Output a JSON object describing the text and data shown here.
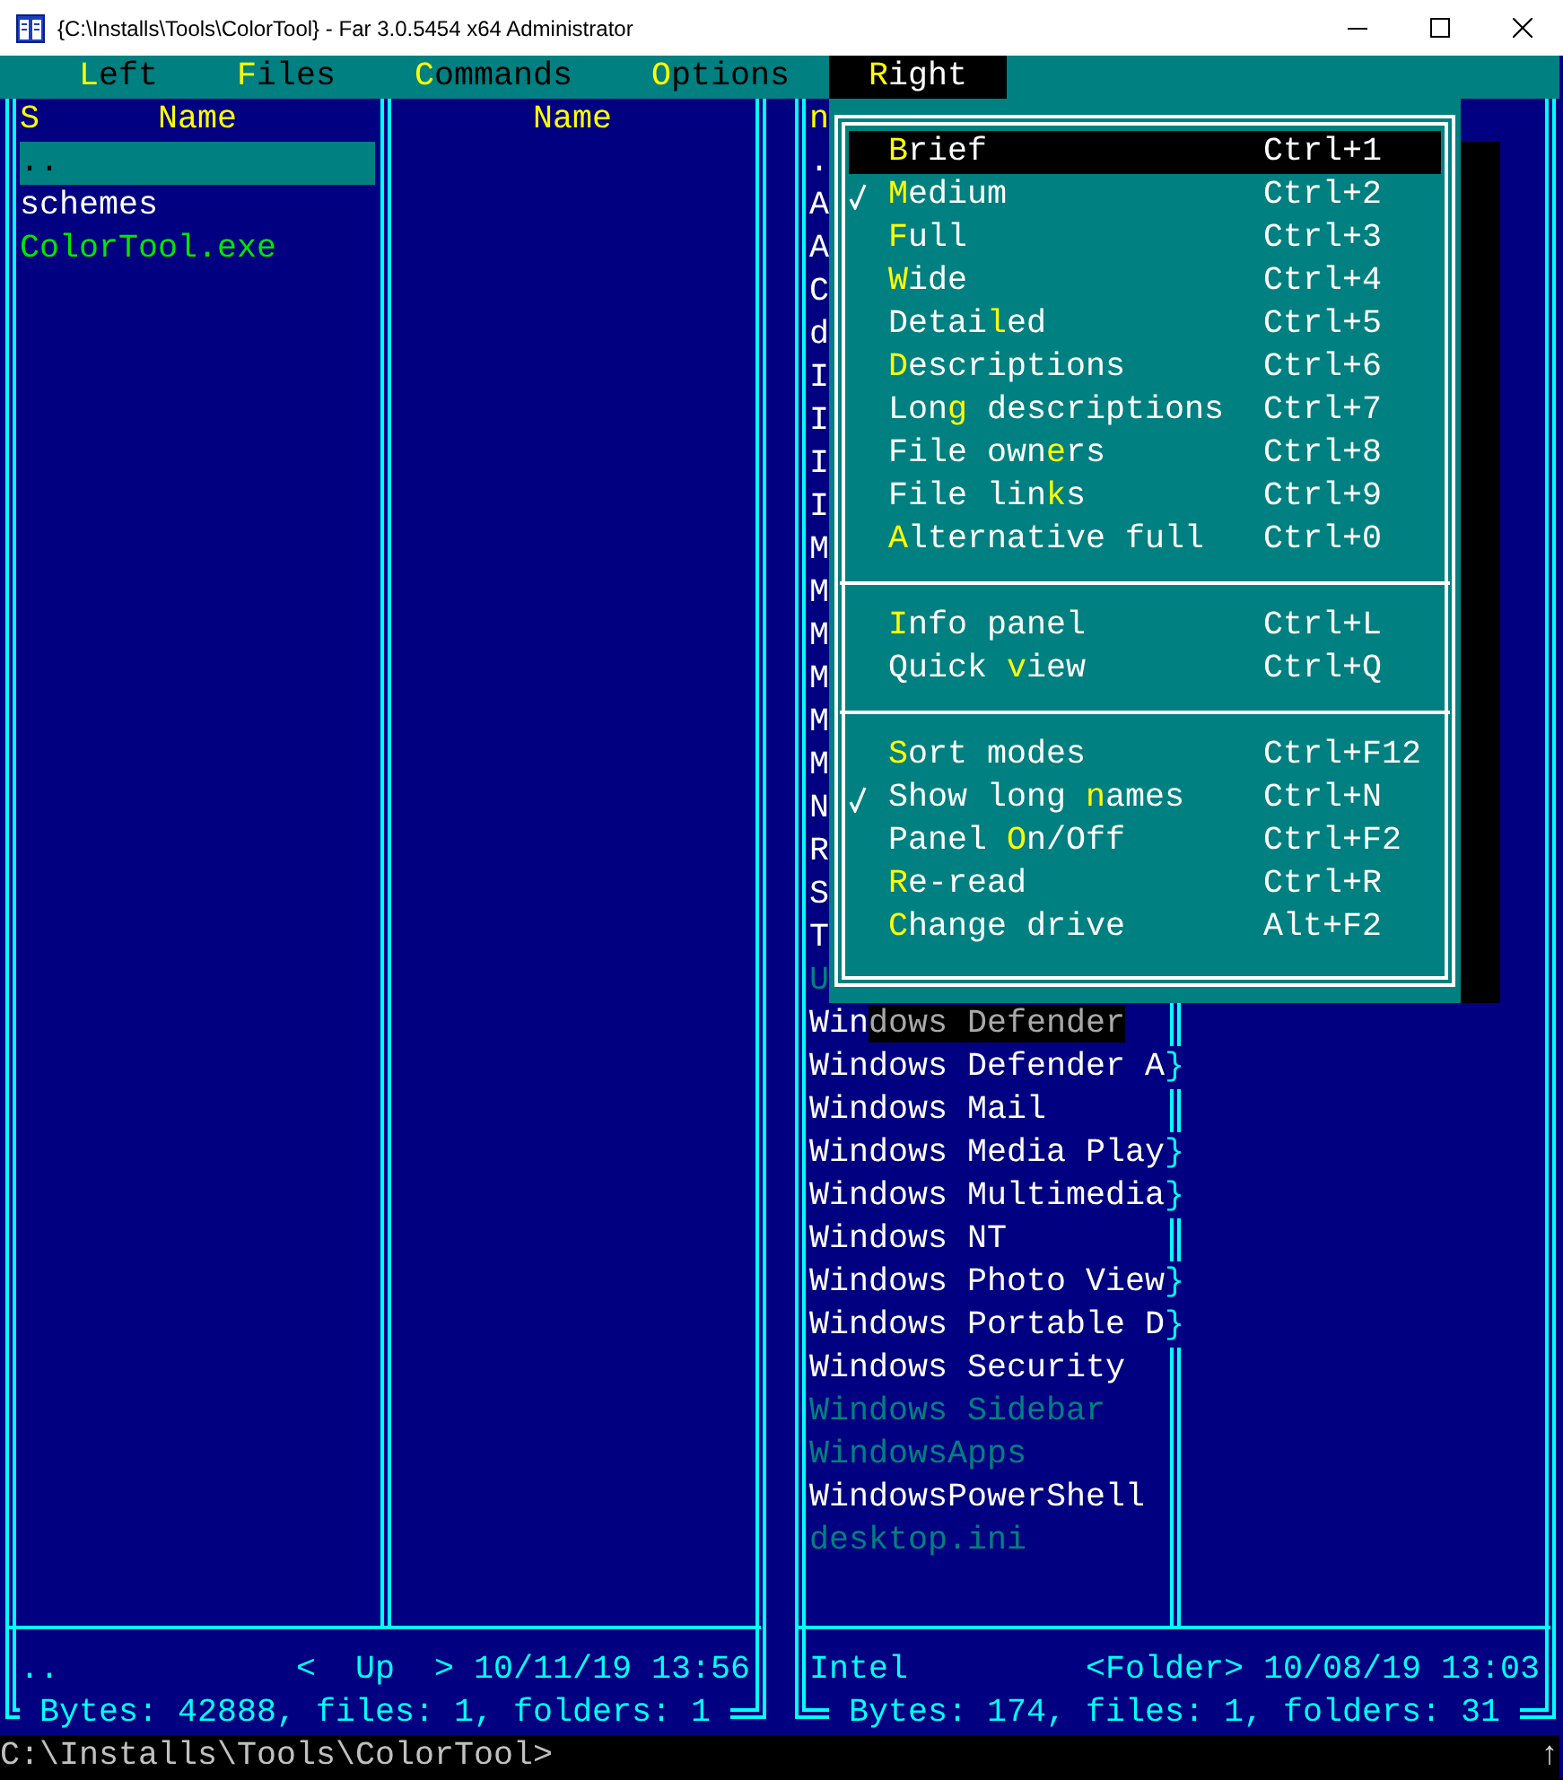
{
  "window": {
    "title": "{C:\\Installs\\Tools\\ColorTool} - Far 3.0.5454 x64 Administrator"
  },
  "menu_bar": {
    "items": [
      {
        "hotkey": "L",
        "suffix": "eft",
        "selected": false
      },
      {
        "hotkey": "F",
        "suffix": "iles",
        "selected": false
      },
      {
        "hotkey": "C",
        "suffix": "ommands",
        "selected": false
      },
      {
        "hotkey": "O",
        "suffix": "ptions",
        "selected": false
      },
      {
        "hotkey": "R",
        "suffix": "ight",
        "selected": true
      }
    ]
  },
  "left_panel": {
    "sort_mark": "S",
    "column_headers": [
      "Name",
      "Name"
    ],
    "files": [
      {
        "name": "..",
        "kind": "up",
        "selected": true
      },
      {
        "name": "schemes",
        "kind": "folder",
        "selected": false
      },
      {
        "name": "ColorTool.exe",
        "kind": "executable",
        "selected": false
      }
    ],
    "info": {
      "name": "..",
      "type": "<  Up  >",
      "date": "10/11/19 13:56"
    },
    "summary": "Bytes: 42888, files: 1, folders: 1"
  },
  "right_panel": {
    "sort_mark": "n",
    "files": [
      {
        "name": ".",
        "kind": "up",
        "selected": false
      },
      {
        "name": "A",
        "kind": "folder",
        "selected": false
      },
      {
        "name": "A",
        "kind": "folder",
        "selected": false
      },
      {
        "name": "C",
        "kind": "folder",
        "selected": false
      },
      {
        "name": "d",
        "kind": "folder",
        "selected": false
      },
      {
        "name": "I",
        "kind": "folder",
        "selected": false
      },
      {
        "name": "I",
        "kind": "folder",
        "selected": false
      },
      {
        "name": "I",
        "kind": "folder",
        "selected": false
      },
      {
        "name": "I",
        "kind": "folder",
        "selected": false
      },
      {
        "name": "M",
        "kind": "folder",
        "selected": false
      },
      {
        "name": "M",
        "kind": "folder",
        "selected": false
      },
      {
        "name": "M",
        "kind": "folder",
        "selected": false
      },
      {
        "name": "M",
        "kind": "folder",
        "selected": false
      },
      {
        "name": "M",
        "kind": "folder",
        "selected": false
      },
      {
        "name": "M",
        "kind": "folder",
        "selected": false
      },
      {
        "name": "N",
        "kind": "folder",
        "selected": false
      },
      {
        "name": "R",
        "kind": "folder",
        "selected": false
      },
      {
        "name": "S",
        "kind": "folder",
        "selected": false
      },
      {
        "name": "T",
        "kind": "folder",
        "selected": false
      },
      {
        "name": "U",
        "kind": "hidden",
        "selected": false
      },
      {
        "name": "Windows Defender",
        "kind": "folder",
        "selected": false
      },
      {
        "name": "Windows Defender A",
        "kind": "folder",
        "selected": false,
        "overflow_mark": "}"
      },
      {
        "name": "Windows Mail",
        "kind": "folder",
        "selected": false
      },
      {
        "name": "Windows Media Play",
        "kind": "folder",
        "selected": false,
        "overflow_mark": "}"
      },
      {
        "name": "Windows Multimedia",
        "kind": "folder",
        "selected": false,
        "overflow_mark": "}"
      },
      {
        "name": "Windows NT",
        "kind": "folder",
        "selected": false
      },
      {
        "name": "Windows Photo View",
        "kind": "folder",
        "selected": false,
        "overflow_mark": "}"
      },
      {
        "name": "Windows Portable D",
        "kind": "folder",
        "selected": false,
        "overflow_mark": "}"
      },
      {
        "name": "Windows Security",
        "kind": "folder",
        "selected": false
      },
      {
        "name": "Windows Sidebar",
        "kind": "hidden",
        "selected": false
      },
      {
        "name": "WindowsApps",
        "kind": "hidden",
        "selected": false
      },
      {
        "name": "WindowsPowerShell",
        "kind": "folder",
        "selected": false
      },
      {
        "name": "desktop.ini",
        "kind": "hidden",
        "selected": false
      }
    ],
    "info": {
      "name": "Intel",
      "type": "<Folder>",
      "date": "10/08/19 13:03"
    },
    "summary": "Bytes: 174, files: 1, folders: 31"
  },
  "dropdown": {
    "items": [
      {
        "kind": "option",
        "hotkey": "B",
        "suffix": "rief",
        "shortcut": "Ctrl+1",
        "checked": false,
        "selected": true
      },
      {
        "kind": "option",
        "hotkey": "M",
        "suffix": "edium",
        "shortcut": "Ctrl+2",
        "checked": true,
        "selected": false
      },
      {
        "kind": "option",
        "hotkey": "F",
        "suffix": "ull",
        "shortcut": "Ctrl+3",
        "checked": false,
        "selected": false
      },
      {
        "kind": "option",
        "hotkey": "W",
        "suffix": "ide",
        "shortcut": "Ctrl+4",
        "checked": false,
        "selected": false
      },
      {
        "kind": "option",
        "prefix": "Detai",
        "hotkey": "l",
        "suffix": "ed",
        "shortcut": "Ctrl+5",
        "checked": false,
        "selected": false
      },
      {
        "kind": "option",
        "hotkey": "D",
        "suffix": "escriptions",
        "shortcut": "Ctrl+6",
        "checked": false,
        "selected": false
      },
      {
        "kind": "option",
        "prefix": "Lon",
        "hotkey": "g",
        "suffix": " descriptions",
        "shortcut": "Ctrl+7",
        "checked": false,
        "selected": false
      },
      {
        "kind": "option",
        "prefix": "File own",
        "hotkey": "e",
        "suffix": "rs",
        "shortcut": "Ctrl+8",
        "checked": false,
        "selected": false
      },
      {
        "kind": "option",
        "prefix": "File lin",
        "hotkey": "k",
        "suffix": "s",
        "shortcut": "Ctrl+9",
        "checked": false,
        "selected": false
      },
      {
        "kind": "option",
        "hotkey": "A",
        "suffix": "lternative full",
        "shortcut": "Ctrl+0",
        "checked": false,
        "selected": false
      },
      {
        "kind": "separator"
      },
      {
        "kind": "option",
        "hotkey": "I",
        "suffix": "nfo panel",
        "shortcut": "Ctrl+L",
        "checked": false,
        "selected": false
      },
      {
        "kind": "option",
        "prefix": "Quick ",
        "hotkey": "v",
        "suffix": "iew",
        "shortcut": "Ctrl+Q",
        "checked": false,
        "selected": false
      },
      {
        "kind": "separator"
      },
      {
        "kind": "option",
        "hotkey": "S",
        "suffix": "ort modes",
        "shortcut": "Ctrl+F12",
        "checked": false,
        "selected": false
      },
      {
        "kind": "option",
        "prefix": "Show long ",
        "hotkey": "n",
        "suffix": "ames",
        "shortcut": "Ctrl+N",
        "checked": true,
        "selected": false
      },
      {
        "kind": "option",
        "prefix": "Panel ",
        "hotkey": "O",
        "suffix": "n/Off",
        "shortcut": "Ctrl+F2",
        "checked": false,
        "selected": false
      },
      {
        "kind": "option",
        "hotkey": "R",
        "suffix": "e-read",
        "shortcut": "Ctrl+R",
        "checked": false,
        "selected": false
      },
      {
        "kind": "option",
        "hotkey": "C",
        "suffix": "hange drive",
        "shortcut": "Alt+F2",
        "checked": false,
        "selected": false
      }
    ]
  },
  "command_line": {
    "prompt": "C:\\Installs\\Tools\\ColorTool>",
    "indicator": "↑"
  }
}
